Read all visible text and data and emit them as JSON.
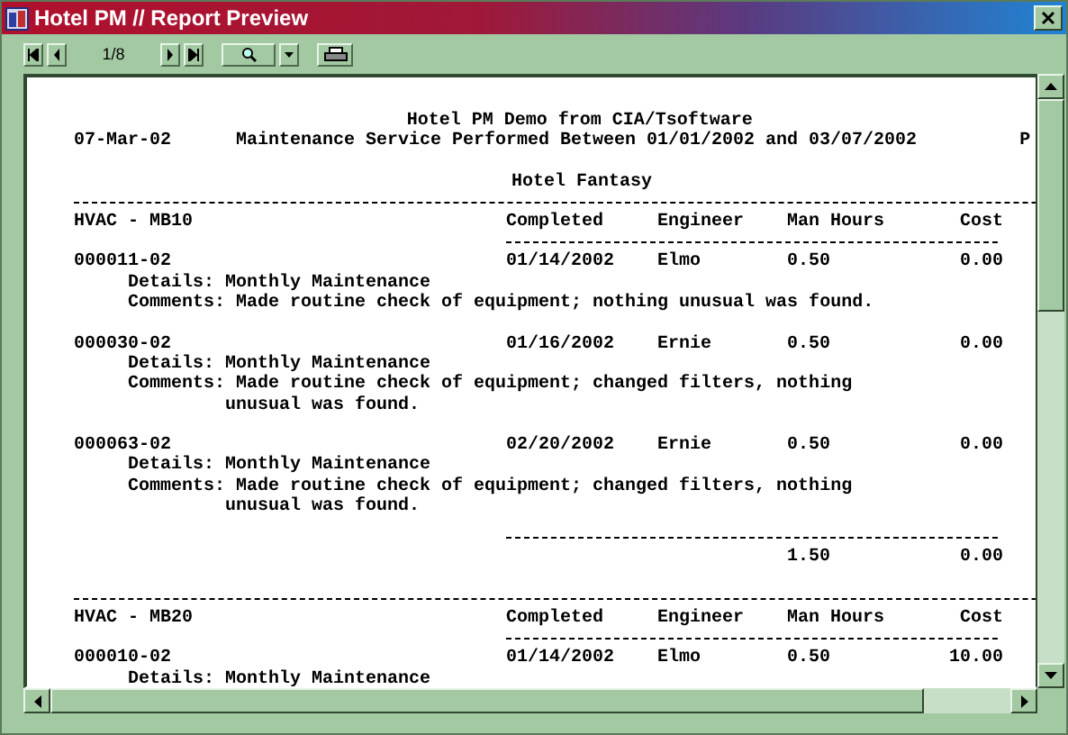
{
  "window": {
    "title": "Hotel PM // Report Preview"
  },
  "toolbar": {
    "page_indicator": "1/8"
  },
  "report": {
    "title": "Hotel PM Demo from CIA/Tsoftware",
    "date": "07-Mar-02",
    "subtitle": "Maintenance Service Performed Between 01/01/2002 and 03/07/2002",
    "page_label": "P",
    "hotel": "Hotel Fantasy",
    "groups": [
      {
        "name": "HVAC - MB10",
        "columns": [
          "Completed",
          "Engineer",
          "Man Hours",
          "Cost"
        ],
        "records": [
          {
            "id": "000011-02",
            "completed": "01/14/2002",
            "engineer": "Elmo",
            "hours": "0.50",
            "cost": "0.00",
            "details": "Details: Monthly Maintenance",
            "comments": [
              "Comments: Made routine check of equipment; nothing unusual was found."
            ]
          },
          {
            "id": "000030-02",
            "completed": "01/16/2002",
            "engineer": "Ernie",
            "hours": "0.50",
            "cost": "0.00",
            "details": "Details: Monthly Maintenance",
            "comments": [
              "Comments: Made routine check of equipment; changed filters, nothing",
              "unusual was found."
            ]
          },
          {
            "id": "000063-02",
            "completed": "02/20/2002",
            "engineer": "Ernie",
            "hours": "0.50",
            "cost": "0.00",
            "details": "Details: Monthly Maintenance",
            "comments": [
              "Comments: Made routine check of equipment; changed filters, nothing",
              "unusual was found."
            ]
          }
        ],
        "total": {
          "hours": "1.50",
          "cost": "0.00"
        }
      },
      {
        "name": "HVAC - MB20",
        "columns": [
          "Completed",
          "Engineer",
          "Man Hours",
          "Cost"
        ],
        "records": [
          {
            "id": "000010-02",
            "completed": "01/14/2002",
            "engineer": "Elmo",
            "hours": "0.50",
            "cost": "10.00",
            "details": "Details: Monthly Maintenance"
          }
        ]
      }
    ]
  }
}
